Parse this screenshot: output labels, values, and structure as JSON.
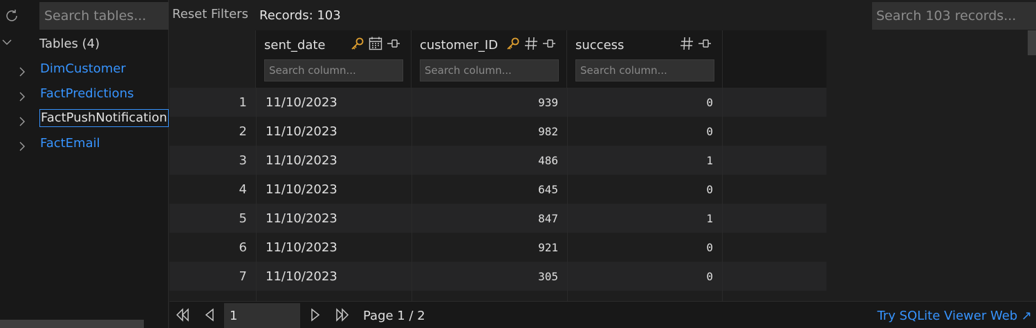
{
  "sidebar": {
    "search_placeholder": "Search tables...",
    "tree_title": "Tables (4)",
    "tables": [
      {
        "name": "DimCustomer",
        "selected": false
      },
      {
        "name": "FactPredictions",
        "selected": false
      },
      {
        "name": "FactPushNotification",
        "selected": true
      },
      {
        "name": "FactEmail",
        "selected": false
      }
    ]
  },
  "toolbar": {
    "reset_label": "Reset Filters",
    "records_label": "Records: 103",
    "search_placeholder": "Search 103 records..."
  },
  "grid": {
    "columns": [
      {
        "name": "sent_date",
        "icons": [
          "key-icon",
          "calendar-icon",
          "pin-icon"
        ],
        "filter_placeholder": "Search column..."
      },
      {
        "name": "customer_ID",
        "icons": [
          "key-icon",
          "hash-icon",
          "pin-icon"
        ],
        "filter_placeholder": "Search column..."
      },
      {
        "name": "success",
        "icons": [
          "hash-icon",
          "pin-icon"
        ],
        "filter_placeholder": "Search column..."
      }
    ],
    "rows": [
      {
        "n": "1",
        "sent_date": "11/10/2023",
        "customer_ID": "939",
        "success": "0"
      },
      {
        "n": "2",
        "sent_date": "11/10/2023",
        "customer_ID": "982",
        "success": "0"
      },
      {
        "n": "3",
        "sent_date": "11/10/2023",
        "customer_ID": "486",
        "success": "1"
      },
      {
        "n": "4",
        "sent_date": "11/10/2023",
        "customer_ID": "645",
        "success": "0"
      },
      {
        "n": "5",
        "sent_date": "11/10/2023",
        "customer_ID": "847",
        "success": "1"
      },
      {
        "n": "6",
        "sent_date": "11/10/2023",
        "customer_ID": "921",
        "success": "0"
      },
      {
        "n": "7",
        "sent_date": "11/10/2023",
        "customer_ID": "305",
        "success": "0"
      }
    ]
  },
  "pagination": {
    "page_value": "1",
    "page_label": "Page 1 / 2",
    "try_link": "Try SQLite Viewer Web ↗"
  },
  "colors": {
    "accent": "#3794ff",
    "key": "#e0a030",
    "background": "#1e1e1e"
  }
}
